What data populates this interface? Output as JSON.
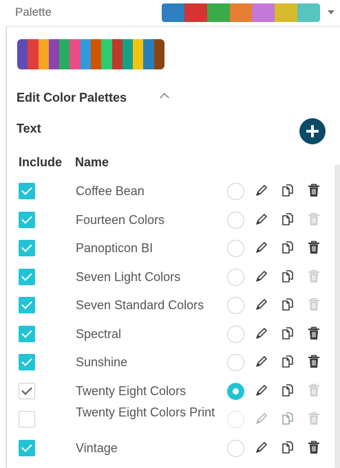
{
  "palette": {
    "label": "Palette",
    "colors": [
      "#2f7fc1",
      "#d63334",
      "#3bab4b",
      "#e67e33",
      "#c478d7",
      "#d7bb2e",
      "#58c4bf"
    ]
  },
  "editor": {
    "preview_colors": [
      "#5e4db2",
      "#e23d3d",
      "#f5a623",
      "#8e44ad",
      "#27ae60",
      "#e84d8a",
      "#3498db",
      "#d35400",
      "#2ecc71",
      "#c0392b",
      "#16a085",
      "#f1c40f",
      "#2980b9",
      "#8b4513"
    ],
    "section_title": "Edit Color Palettes",
    "text_label": "Text",
    "col_include": "Include",
    "col_name": "Name",
    "accent": "#22c3d4",
    "add_button_color": "#0c4a66",
    "rows": [
      {
        "name": "Coffee Bean",
        "include": "checked",
        "default": false,
        "deletable": true
      },
      {
        "name": "Fourteen Colors",
        "include": "checked",
        "default": false,
        "deletable": false
      },
      {
        "name": "Panopticon BI",
        "include": "checked",
        "default": false,
        "deletable": true
      },
      {
        "name": "Seven Light Colors",
        "include": "checked",
        "default": false,
        "deletable": false
      },
      {
        "name": "Seven Standard Colors",
        "include": "checked",
        "default": false,
        "deletable": false
      },
      {
        "name": "Spectral",
        "include": "checked",
        "default": false,
        "deletable": true
      },
      {
        "name": "Sunshine",
        "include": "checked",
        "default": false,
        "deletable": true
      },
      {
        "name": "Twenty Eight Colors",
        "include": "checked-plain",
        "default": true,
        "deletable": false
      },
      {
        "name": "Twenty Eight Colors Print",
        "include": "unchecked",
        "default": false,
        "deletable": false
      },
      {
        "name": "Vintage",
        "include": "checked",
        "default": false,
        "deletable": true
      }
    ]
  }
}
